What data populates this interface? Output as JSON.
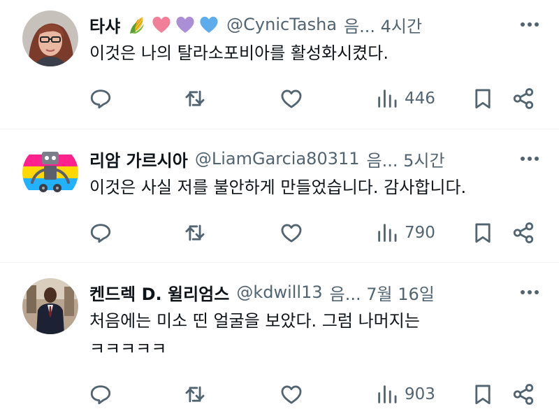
{
  "tweets": [
    {
      "name": "타샤",
      "emojis": [
        "corn-emoji",
        "pink-heart-emoji",
        "purple-heart-emoji",
        "blue-heart-emoji"
      ],
      "handle": "@CynicTasha",
      "meta": "음... 4시간",
      "lines": [
        "이것은 나의 탈라소포비아를 활성화시켰다."
      ],
      "views": "446"
    },
    {
      "name": "리암 가르시아",
      "emojis": [],
      "handle": "@LiamGarcia80311",
      "meta": "음... 5시간",
      "lines": [
        "이것은 사실 저를 불안하게 만들었습니다. 감사합니다."
      ],
      "views": "790"
    },
    {
      "name": "켄드렉 D. 윌리엄스",
      "emojis": [],
      "handle": "@kdwill13",
      "meta": "음... 7월 16일",
      "lines": [
        "처음에는 미소 띤 얼굴을 보았다. 그럼 나머지는",
        "ㅋㅋㅋㅋㅋ"
      ],
      "views": "903"
    }
  ],
  "colors": {
    "text": "#0f1419",
    "secondary": "#536471",
    "divider": "#eff3f4",
    "icon": "#536471"
  }
}
